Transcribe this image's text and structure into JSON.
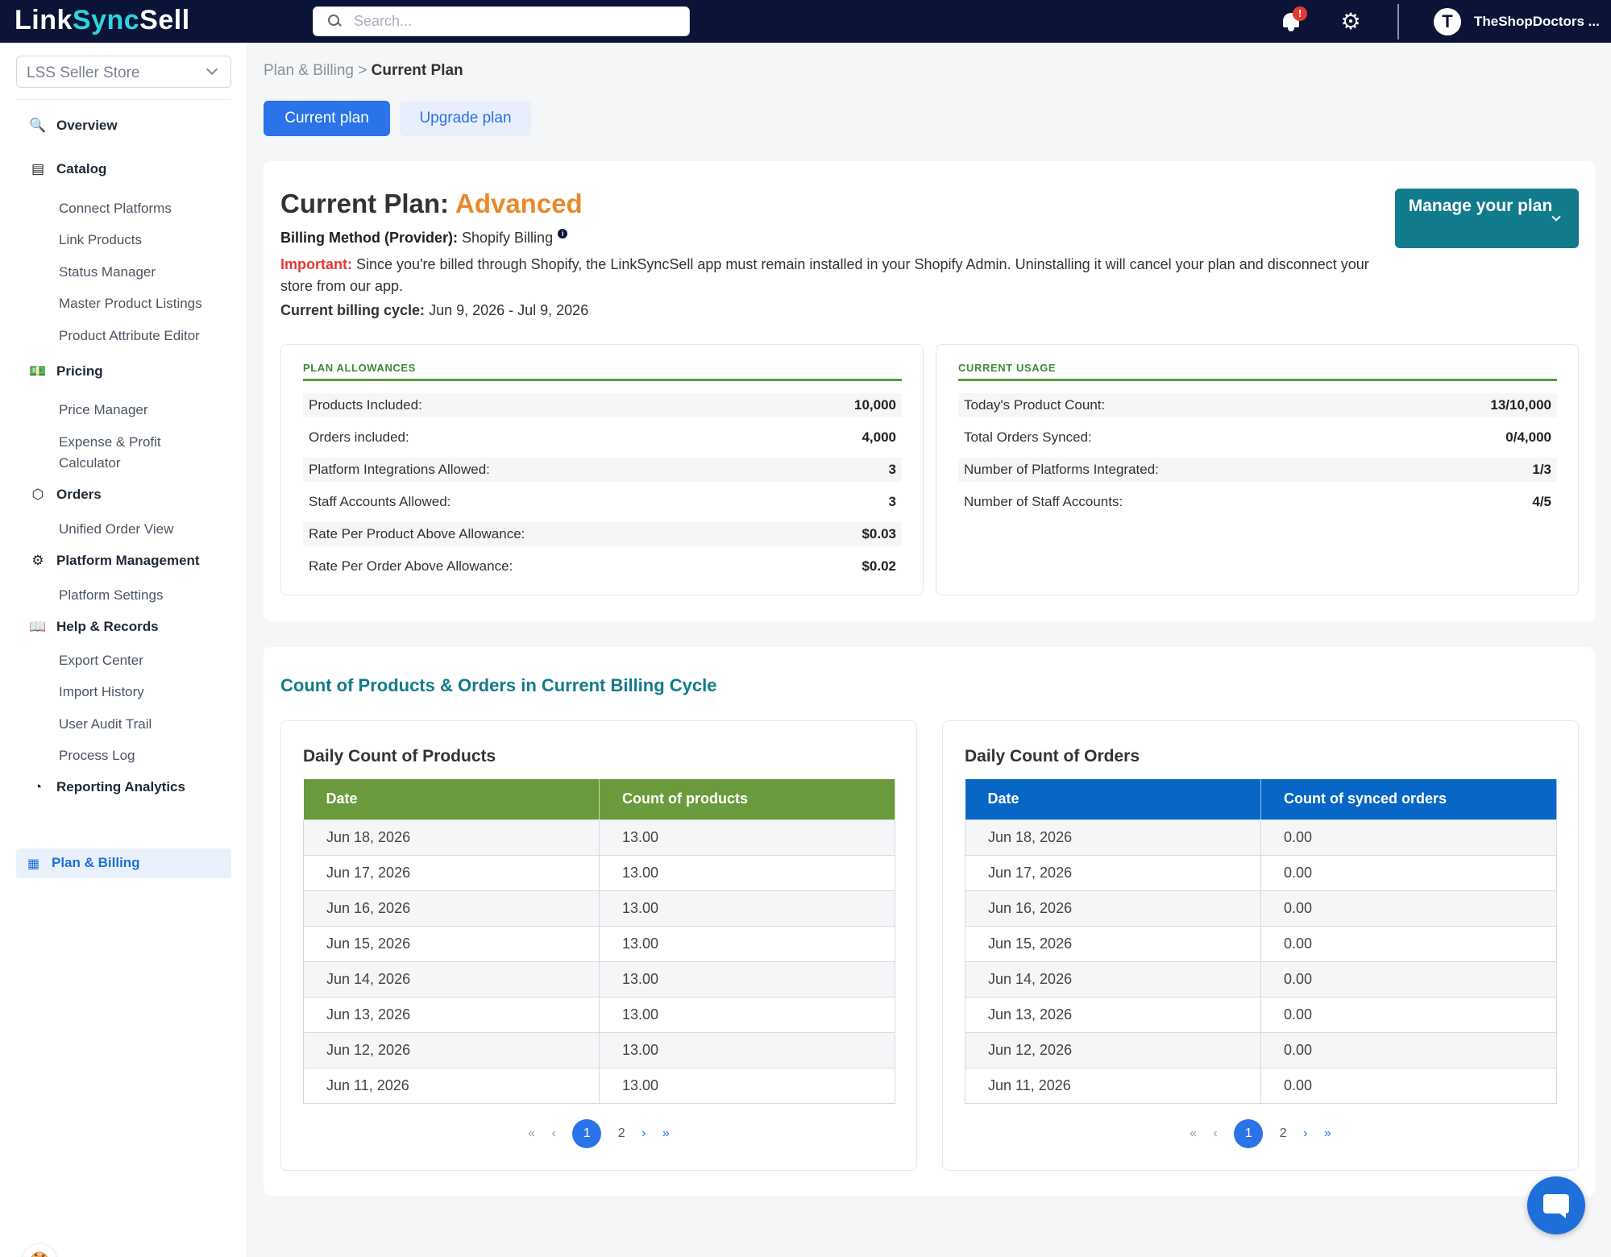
{
  "app": {
    "logo_main": "Link",
    "logo_mid": "Sync",
    "logo_end": "Sell",
    "search_placeholder": "Search...",
    "notification_badge": "!",
    "avatar_letter": "T",
    "user_name": "TheShopDoctors ..."
  },
  "sidebar": {
    "store_selector": "LSS Seller Store",
    "sections": {
      "overview": "Overview",
      "catalog": "Catalog",
      "pricing": "Pricing",
      "orders": "Orders",
      "platform_management": "Platform Management",
      "help_records": "Help & Records",
      "reporting": "Reporting Analytics",
      "plan_billing": "Plan & Billing"
    },
    "items": {
      "connect_platforms": "Connect Platforms",
      "link_products": "Link Products",
      "status_manager": "Status Manager",
      "master_listings": "Master Product Listings",
      "attribute_editor": "Product Attribute Editor",
      "price_manager": "Price Manager",
      "expense_profit_1": "Expense & Profit",
      "expense_profit_2": "Calculator",
      "unified_order": "Unified Order View",
      "platform_settings": "Platform Settings",
      "export_center": "Export Center",
      "import_history": "Import History",
      "user_audit": "User Audit Trail",
      "process_log": "Process Log"
    }
  },
  "breadcrumb": {
    "parent": "Plan & Billing",
    "separator": ">",
    "current": "Current Plan"
  },
  "tabs": {
    "current": "Current plan",
    "upgrade": "Upgrade plan"
  },
  "plan": {
    "title_prefix": "Current Plan:",
    "plan_name": "Advanced",
    "manage_button": "Manage your plan",
    "billing_label": "Billing Method (Provider):",
    "billing_value": "Shopify Billing",
    "important_label": "Important:",
    "important_text": "Since you're billed through Shopify, the LinkSyncSell app must remain installed in your Shopify Admin. Uninstalling it will cancel your plan and disconnect your store from our app.",
    "cycle_label": "Current billing cycle:",
    "cycle_value": "Jun 9, 2026 - Jul 9, 2026"
  },
  "allowances": {
    "title": "PLAN ALLOWANCES",
    "rows": [
      {
        "label": "Products Included:",
        "value": "10,000"
      },
      {
        "label": "Orders included:",
        "value": "4,000"
      },
      {
        "label": "Platform Integrations Allowed:",
        "value": "3"
      },
      {
        "label": "Staff Accounts Allowed:",
        "value": "3"
      },
      {
        "label": "Rate Per Product Above Allowance:",
        "value": "$0.03"
      },
      {
        "label": "Rate Per Order Above Allowance:",
        "value": "$0.02"
      }
    ]
  },
  "usage": {
    "title": "CURRENT USAGE",
    "rows": [
      {
        "label": "Today's Product Count:",
        "value": "13/10,000"
      },
      {
        "label": "Total Orders Synced:",
        "value": "0/4,000"
      },
      {
        "label": "Number of Platforms Integrated:",
        "value": "1/3"
      },
      {
        "label": "Number of Staff Accounts:",
        "value": "4/5"
      }
    ]
  },
  "counts": {
    "section_title": "Count of Products & Orders in Current Billing Cycle",
    "products": {
      "title": "Daily Count of Products",
      "col_date": "Date",
      "col_count": "Count of products",
      "rows": [
        {
          "date": "Jun 18, 2026",
          "count": "13.00"
        },
        {
          "date": "Jun 17, 2026",
          "count": "13.00"
        },
        {
          "date": "Jun 16, 2026",
          "count": "13.00"
        },
        {
          "date": "Jun 15, 2026",
          "count": "13.00"
        },
        {
          "date": "Jun 14, 2026",
          "count": "13.00"
        },
        {
          "date": "Jun 13, 2026",
          "count": "13.00"
        },
        {
          "date": "Jun 12, 2026",
          "count": "13.00"
        },
        {
          "date": "Jun 11, 2026",
          "count": "13.00"
        }
      ]
    },
    "orders": {
      "title": "Daily Count of Orders",
      "col_date": "Date",
      "col_count": "Count of synced orders",
      "rows": [
        {
          "date": "Jun 18, 2026",
          "count": "0.00"
        },
        {
          "date": "Jun 17, 2026",
          "count": "0.00"
        },
        {
          "date": "Jun 16, 2026",
          "count": "0.00"
        },
        {
          "date": "Jun 15, 2026",
          "count": "0.00"
        },
        {
          "date": "Jun 14, 2026",
          "count": "0.00"
        },
        {
          "date": "Jun 13, 2026",
          "count": "0.00"
        },
        {
          "date": "Jun 12, 2026",
          "count": "0.00"
        },
        {
          "date": "Jun 11, 2026",
          "count": "0.00"
        }
      ]
    },
    "pager": {
      "first": "«",
      "prev": "‹",
      "page1": "1",
      "page2": "2",
      "next": "›",
      "last": "»"
    }
  }
}
